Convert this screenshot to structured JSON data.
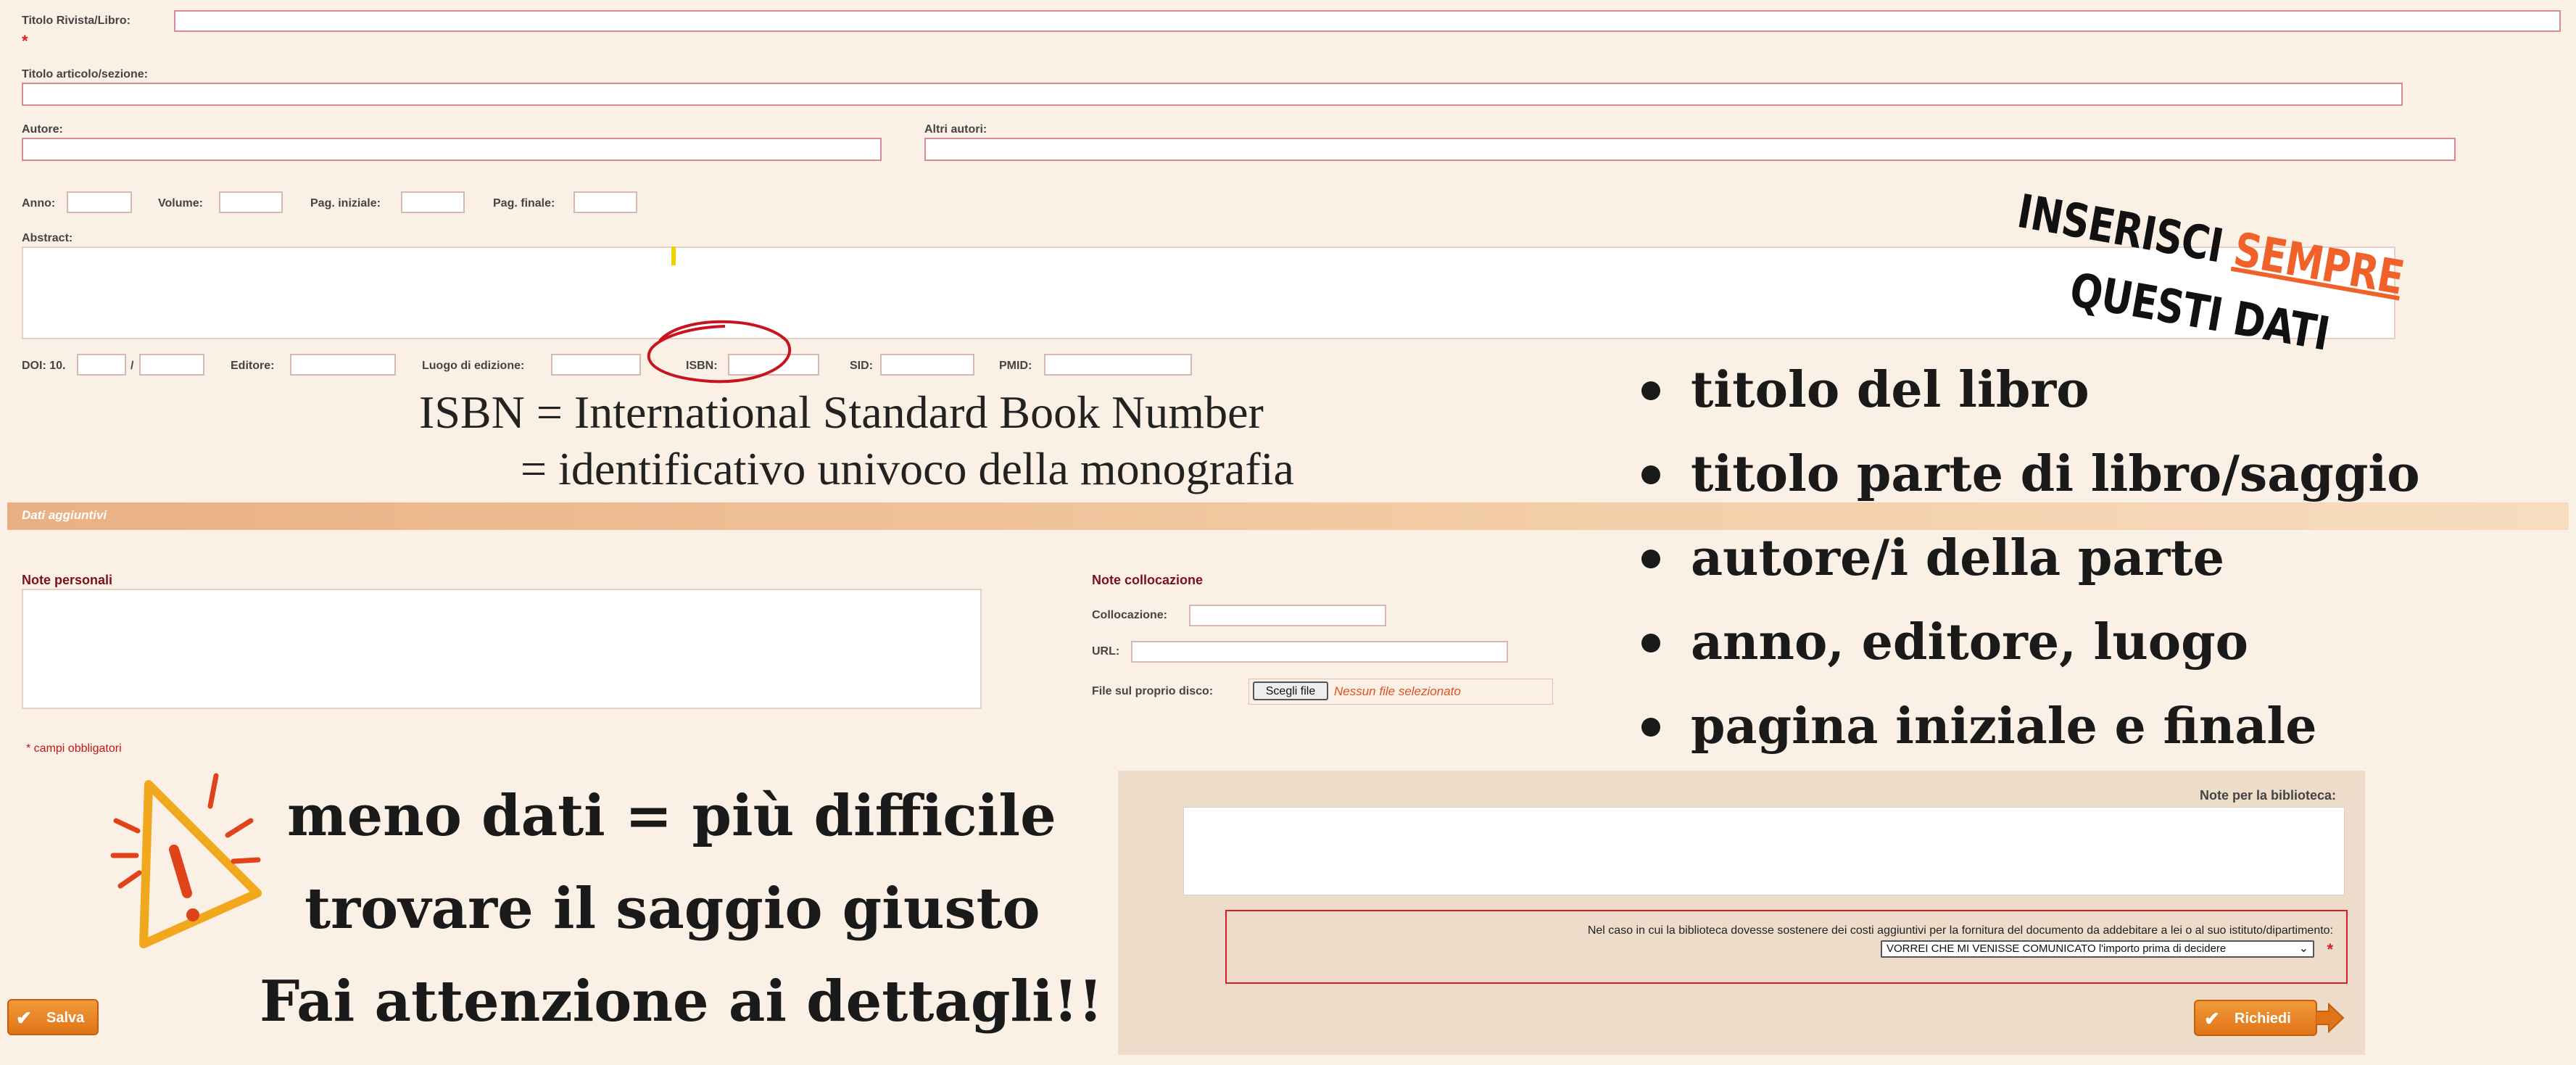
{
  "form": {
    "title_label": "Titolo Rivista/Libro:",
    "required_mark": "*",
    "article_label": "Titolo articolo/sezione:",
    "author_label": "Autore:",
    "other_authors_label": "Altri autori:",
    "year_label": "Anno:",
    "volume_label": "Volume:",
    "page_start_label": "Pag. iniziale:",
    "page_end_label": "Pag. finale:",
    "abstract_label": "Abstract:",
    "doi_label": "DOI: 10.",
    "doi_sep": "/",
    "publisher_label": "Editore:",
    "place_label": "Luogo di edizione:",
    "isbn_label": "ISBN:",
    "sid_label": "SID:",
    "pmid_label": "PMID:"
  },
  "isbn_note": {
    "line1": "ISBN = International Standard Book Number",
    "line2": "= identificativo univoco della monografia"
  },
  "section": {
    "title": "Dati aggiuntivi"
  },
  "extra": {
    "personal_notes_label": "Note personali",
    "location_notes_label": "Note collocazione",
    "location_label": "Collocazione:",
    "url_label": "URL:",
    "file_label": "File sul proprio disco:",
    "file_button": "Scegli file",
    "file_status": "Nessun file selezionato",
    "required_note": "* campi obbligatori"
  },
  "panel": {
    "library_notes_label": "Note per la biblioteca:",
    "cost_text": "Nel caso in cui la biblioteca dovesse sostenere dei costi aggiuntivi per la fornitura del documento da addebitare a lei o al suo istituto/dipartimento:",
    "cost_option": "VORREI CHE MI VENISSE COMUNICATO l'importo prima di decidere",
    "required_mark": "*",
    "request_button": "Richiedi"
  },
  "save_button": "Salva",
  "callout": {
    "line1": "INSERISCI",
    "highlight": "SEMPRE",
    "line2": "QUESTI DATI",
    "highlight_color": "#f0622a"
  },
  "bullets": [
    "titolo del libro",
    "titolo parte di libro/saggio",
    "autore/i della parte",
    "anno, editore, luogo",
    "pagina iniziale e finale"
  ],
  "warning": {
    "icon": "warning-icon",
    "line1": "meno dati = più difficile",
    "line2": "trovare il saggio giusto",
    "line3": "Fai attenzione ai dettagli!!"
  }
}
